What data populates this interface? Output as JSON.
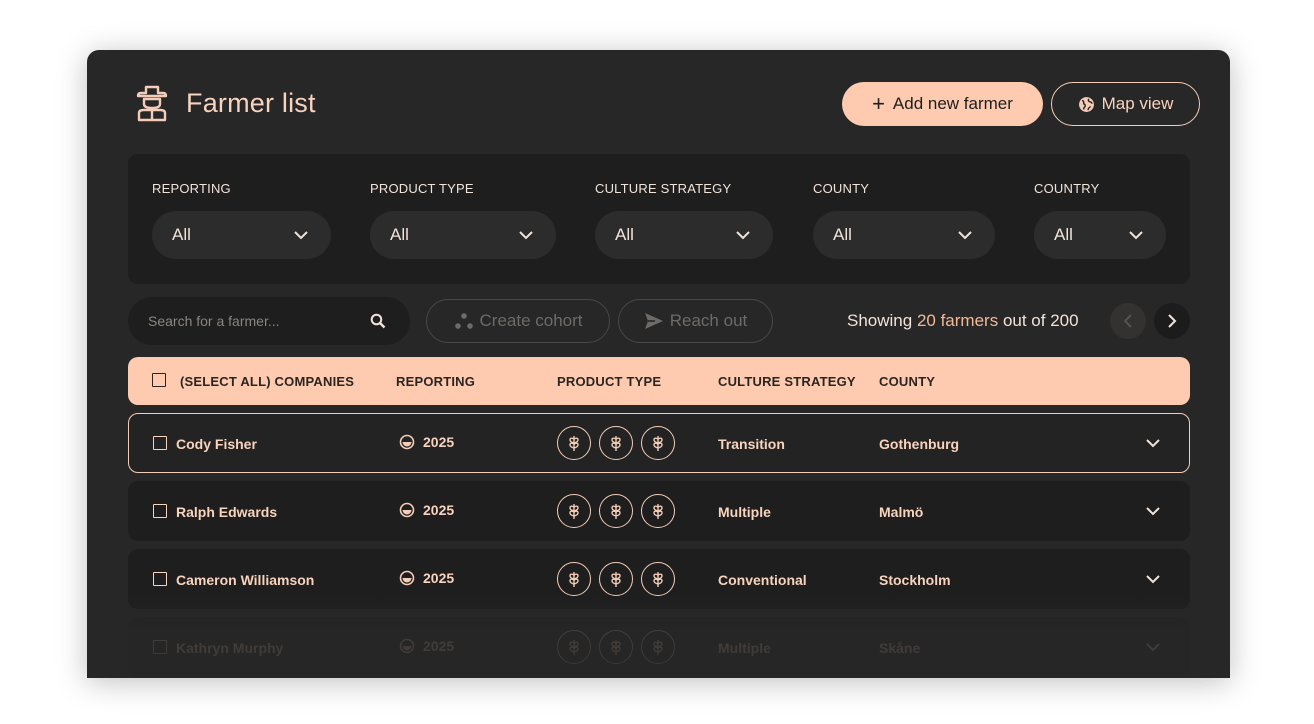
{
  "header": {
    "title": "Farmer list",
    "add_button_label": "Add new farmer",
    "map_button_label": "Map view"
  },
  "filters": [
    {
      "label": "REPORTING",
      "value": "All"
    },
    {
      "label": "PRODUCT TYPE",
      "value": "All"
    },
    {
      "label": "CULTURE STRATEGY",
      "value": "All"
    },
    {
      "label": "COUNTY",
      "value": "All"
    },
    {
      "label": "COUNTRY",
      "value": "All"
    }
  ],
  "toolbar": {
    "search_placeholder": "Search for a farmer...",
    "create_cohort_label": "Create cohort",
    "reach_out_label": "Reach out",
    "showing_prefix": "Showing",
    "showing_count": "20 farmers",
    "showing_suffix": "out of 200"
  },
  "table": {
    "columns": [
      "(SELECT ALL) COMPANIES",
      "REPORTING",
      "PRODUCT TYPE",
      "CULTURE STRATEGY",
      "COUNTY"
    ],
    "rows": [
      {
        "name": "Cody Fisher",
        "reporting": "2025",
        "strategy": "Transition",
        "county": "Gothenburg",
        "selected": true
      },
      {
        "name": "Ralph Edwards",
        "reporting": "2025",
        "strategy": "Multiple",
        "county": "Malmö",
        "selected": false
      },
      {
        "name": "Cameron Williamson",
        "reporting": "2025",
        "strategy": "Conventional",
        "county": "Stockholm",
        "selected": false
      },
      {
        "name": "Kathryn Murphy",
        "reporting": "2025",
        "strategy": "Multiple",
        "county": "Skåne",
        "selected": false
      }
    ]
  },
  "colors": {
    "accent": "#ffcbb0",
    "panel_bg": "#272727",
    "card_bg": "#1e1e1e",
    "text": "#f8d3bd"
  },
  "icons": [
    "farmer-logo-icon",
    "plus-icon",
    "globe-icon",
    "chevron-down-icon",
    "search-icon",
    "cohort-icon",
    "send-icon",
    "chevron-left-icon",
    "chevron-right-icon",
    "reporting-status-icon",
    "wheat-icon"
  ]
}
